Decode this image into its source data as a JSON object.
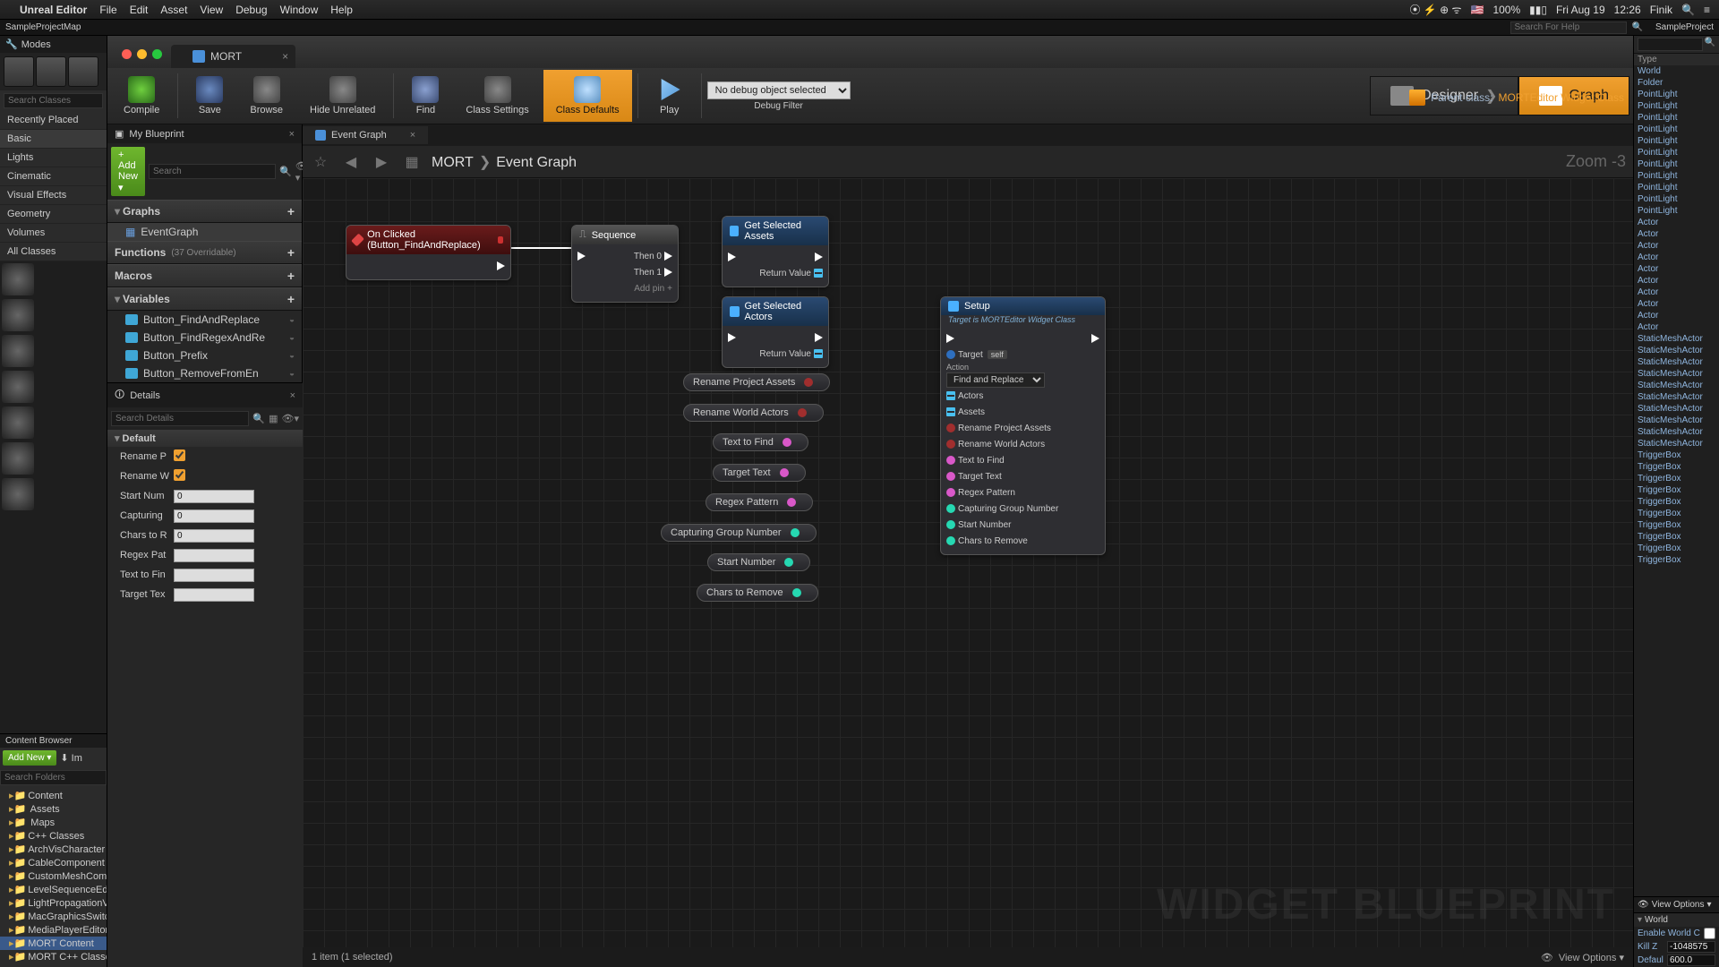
{
  "mac_menu": {
    "app": "Unreal Editor",
    "items": [
      "File",
      "Edit",
      "Asset",
      "View",
      "Debug",
      "Window",
      "Help"
    ],
    "battery": "100%",
    "date": "Fri Aug 19",
    "time": "12:26",
    "user": "Finik"
  },
  "project_bar": {
    "map": "SampleProjectMap",
    "help_placeholder": "Search For Help",
    "project": "SampleProject"
  },
  "modes": {
    "title": "Modes",
    "search_placeholder": "Search Classes",
    "categories": [
      "Recently Placed",
      "Basic",
      "Lights",
      "Cinematic",
      "Visual Effects",
      "Geometry",
      "Volumes",
      "All Classes"
    ]
  },
  "content_browser": {
    "title": "Content Browser",
    "add_new": "Add New",
    "import_label": "Im",
    "search_placeholder": "Search Folders",
    "tree": [
      "Content",
      " Assets",
      " Maps",
      "C++ Classes",
      "ArchVisCharacter",
      "CableComponent",
      "CustomMeshComp",
      "LevelSequenceEd",
      "LightPropagationVolume C++ Classes",
      "MacGraphicsSwitching C++ Classes",
      "MediaPlayerEditor C++ Classes",
      "MORT Content",
      "MORT C++ Classes"
    ],
    "tree_selected_index": 11
  },
  "bp_tab": {
    "name": "MORT"
  },
  "parent_class": {
    "label": "Parent class:",
    "value": "MORTEditor Widget Class"
  },
  "toolbar": {
    "compile": "Compile",
    "save": "Save",
    "browse": "Browse",
    "hide_unrelated": "Hide Unrelated",
    "find": "Find",
    "class_settings": "Class Settings",
    "class_defaults": "Class Defaults",
    "play": "Play",
    "debug_object": "No debug object selected",
    "debug_filter_label": "Debug Filter",
    "designer": "Designer",
    "graph": "Graph"
  },
  "my_bp": {
    "title": "My Blueprint",
    "add_new": "Add New",
    "search_placeholder": "Search",
    "sections": {
      "graphs": "Graphs",
      "event_graph": "EventGraph",
      "functions": "Functions",
      "functions_sub": "(37 Overridable)",
      "macros": "Macros",
      "variables": "Variables"
    },
    "variables": [
      "Button_FindAndReplace",
      "Button_FindRegexAndRe",
      "Button_Prefix",
      "Button_RemoveFromEn"
    ]
  },
  "details": {
    "title": "Details",
    "search_placeholder": "Search Details",
    "section": "Default",
    "rows": {
      "rename_p": "Rename P",
      "rename_w": "Rename W",
      "start_num": "Start Num",
      "start_num_val": "0",
      "capturing": "Capturing",
      "capturing_val": "0",
      "chars_to_r": "Chars to R",
      "chars_to_r_val": "0",
      "regex_pat": "Regex Pat",
      "text_to_fin": "Text to Fin",
      "target_tex": "Target Tex"
    }
  },
  "graph": {
    "tab": "Event Graph",
    "crumb_root": "MORT",
    "crumb_leaf": "Event Graph",
    "zoom": "Zoom -3",
    "status": "1 item (1 selected)",
    "view_options": "View Options",
    "watermark": "WIDGET BLUEPRINT"
  },
  "nodes": {
    "on_clicked": "On Clicked (Button_FindAndReplace)",
    "sequence": "Sequence",
    "sequence_then0": "Then 0",
    "sequence_then1": "Then 1",
    "sequence_addpin": "Add pin",
    "get_sel_assets": "Get Selected Assets",
    "get_sel_actors": "Get Selected Actors",
    "return_value": "Return Value",
    "setup": "Setup",
    "setup_sub": "Target is MORTEditor Widget Class",
    "setup_pins": {
      "target": "Target",
      "self": "self",
      "action": "Action",
      "action_val": "Find and Replace",
      "actors": "Actors",
      "assets": "Assets",
      "rpa": "Rename Project Assets",
      "rwa": "Rename World Actors",
      "ttf": "Text to Find",
      "tt": "Target Text",
      "rp": "Regex Pattern",
      "cgn": "Capturing Group Number",
      "sn": "Start Number",
      "ctr": "Chars to Remove"
    },
    "pills": {
      "rpa": "Rename Project Assets",
      "rwa": "Rename World Actors",
      "ttf": "Text to Find",
      "tt": "Target Text",
      "rp": "Regex Pattern",
      "cgn": "Capturing Group Number",
      "sn": "Start Number",
      "ctr": "Chars to Remove"
    }
  },
  "outliner": {
    "search_placeholder": "",
    "col": "Type",
    "items": [
      "World",
      "Folder",
      "PointLight",
      "PointLight",
      "PointLight",
      "PointLight",
      "PointLight",
      "PointLight",
      "PointLight",
      "PointLight",
      "PointLight",
      "PointLight",
      "PointLight",
      "Actor",
      "Actor",
      "Actor",
      "Actor",
      "Actor",
      "Actor",
      "Actor",
      "Actor",
      "Actor",
      "Actor",
      "StaticMeshActor",
      "StaticMeshActor",
      "StaticMeshActor",
      "StaticMeshActor",
      "StaticMeshActor",
      "StaticMeshActor",
      "StaticMeshActor",
      "StaticMeshActor",
      "StaticMeshActor",
      "StaticMeshActor",
      "TriggerBox",
      "TriggerBox",
      "TriggerBox",
      "TriggerBox",
      "TriggerBox",
      "TriggerBox",
      "TriggerBox",
      "TriggerBox",
      "TriggerBox",
      "TriggerBox"
    ],
    "view_options": "View Options"
  },
  "world": {
    "title": "World",
    "rows": {
      "enable_compos": "Enable World Compos",
      "kill_z": "Kill Z",
      "kill_z_val": "-1048575",
      "max_dist": "Default Max Distance",
      "max_dist_val": "600.0"
    }
  }
}
